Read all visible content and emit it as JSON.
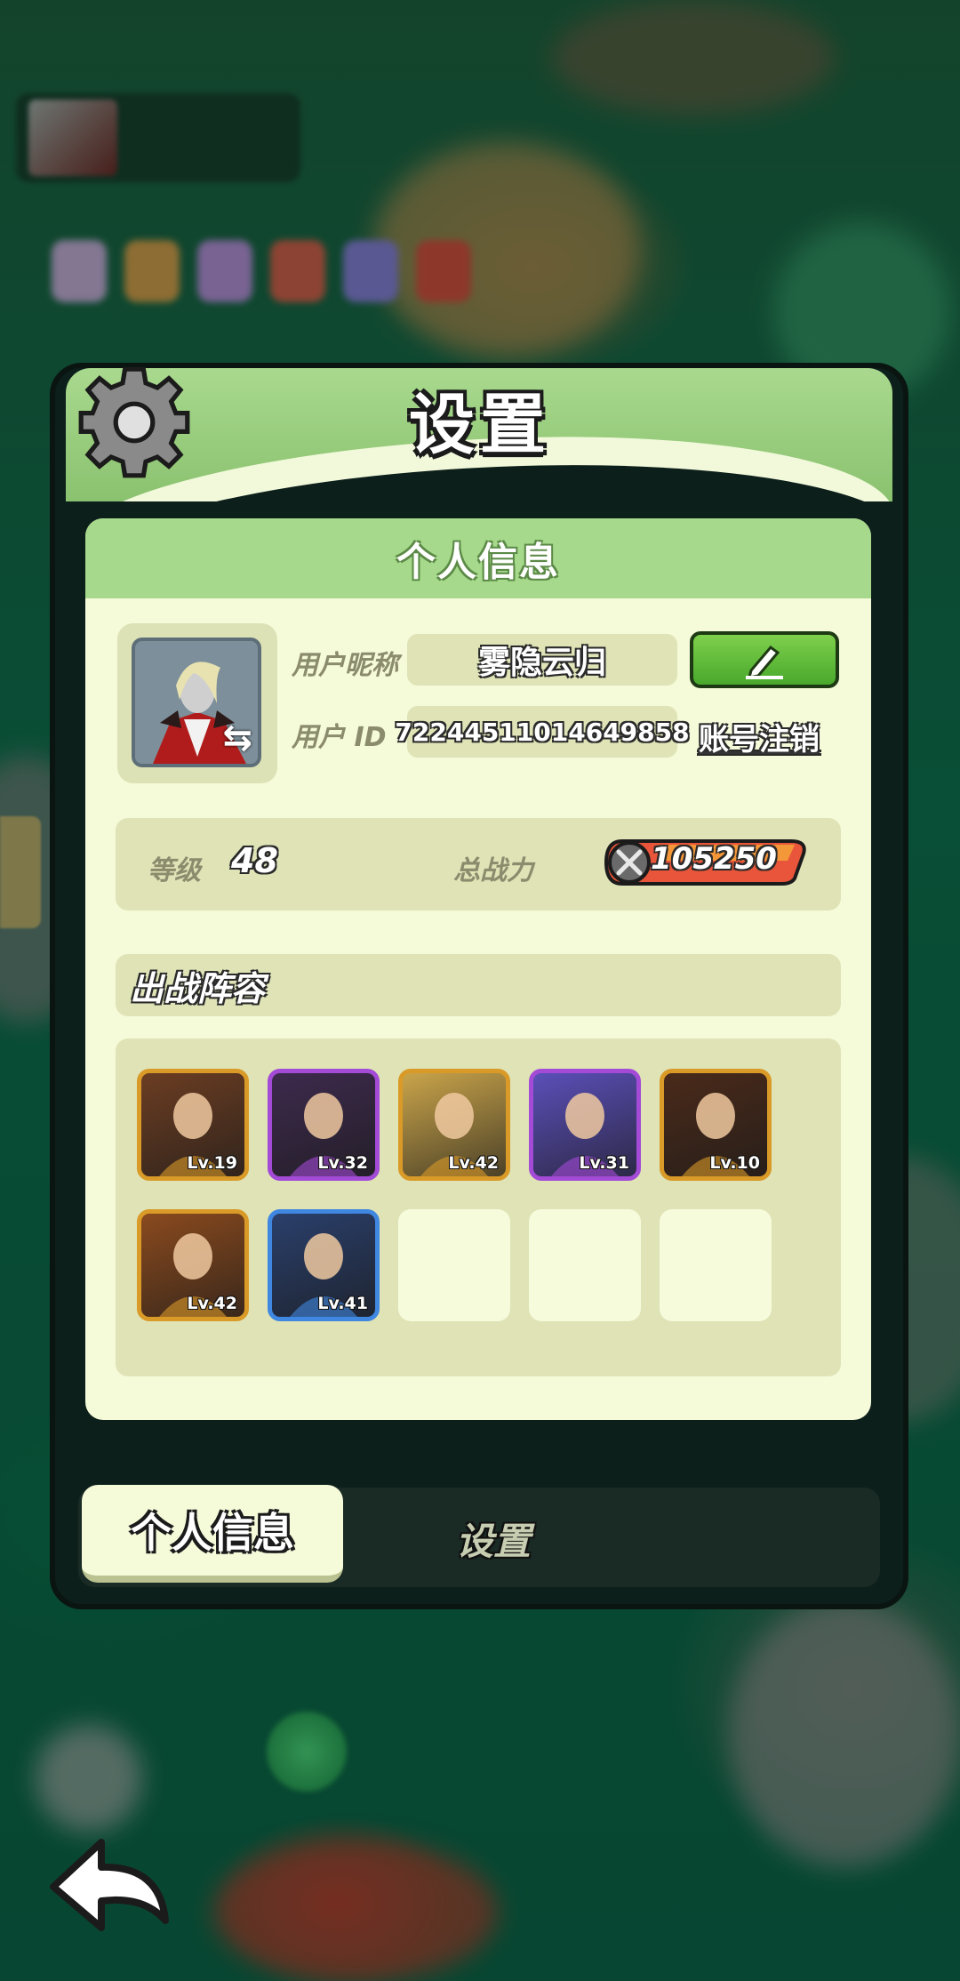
{
  "dialog": {
    "title": "设置",
    "gear_icon": "gear-icon"
  },
  "profile": {
    "section_title": "个人信息",
    "nickname_label": "用户昵称",
    "nickname": "雾隐云归",
    "id_label": "用户 ID",
    "user_id": "72244511014649858",
    "edit_icon": "pencil-icon",
    "logout_label": "账号注销",
    "avatar_icon": "vampire-hero-portrait",
    "swap_icon": "swap-arrows-icon"
  },
  "stats": {
    "level_label": "等级",
    "level": "48",
    "power_label": "总战力",
    "power": "105250",
    "power_icon": "crossed-swords-icon"
  },
  "lineup": {
    "title": "出战阵容",
    "heroes": [
      {
        "lv": "Lv.19",
        "frame": "#d99a28",
        "bg": "#6b3d22"
      },
      {
        "lv": "Lv.32",
        "frame": "#a34ad6",
        "bg": "#3d2a4d"
      },
      {
        "lv": "Lv.42",
        "frame": "#d99a28",
        "bg": "#c9a44a"
      },
      {
        "lv": "Lv.31",
        "frame": "#a34ad6",
        "bg": "#5b4fb8"
      },
      {
        "lv": "Lv.10",
        "frame": "#d99a28",
        "bg": "#4a2a1a"
      },
      {
        "lv": "Lv.42",
        "frame": "#d99a28",
        "bg": "#8a4a1e"
      },
      {
        "lv": "Lv.41",
        "frame": "#3f87e0",
        "bg": "#2a3f6b"
      }
    ],
    "empty_slots": 3
  },
  "tabs": {
    "active": "个人信息",
    "inactive": "设置"
  },
  "nav": {
    "back_icon": "back-arrow-icon"
  },
  "colors": {
    "panel_bg": "#f5fad9",
    "header_green": "#a6d98b",
    "accent_green": "#49a82c"
  }
}
